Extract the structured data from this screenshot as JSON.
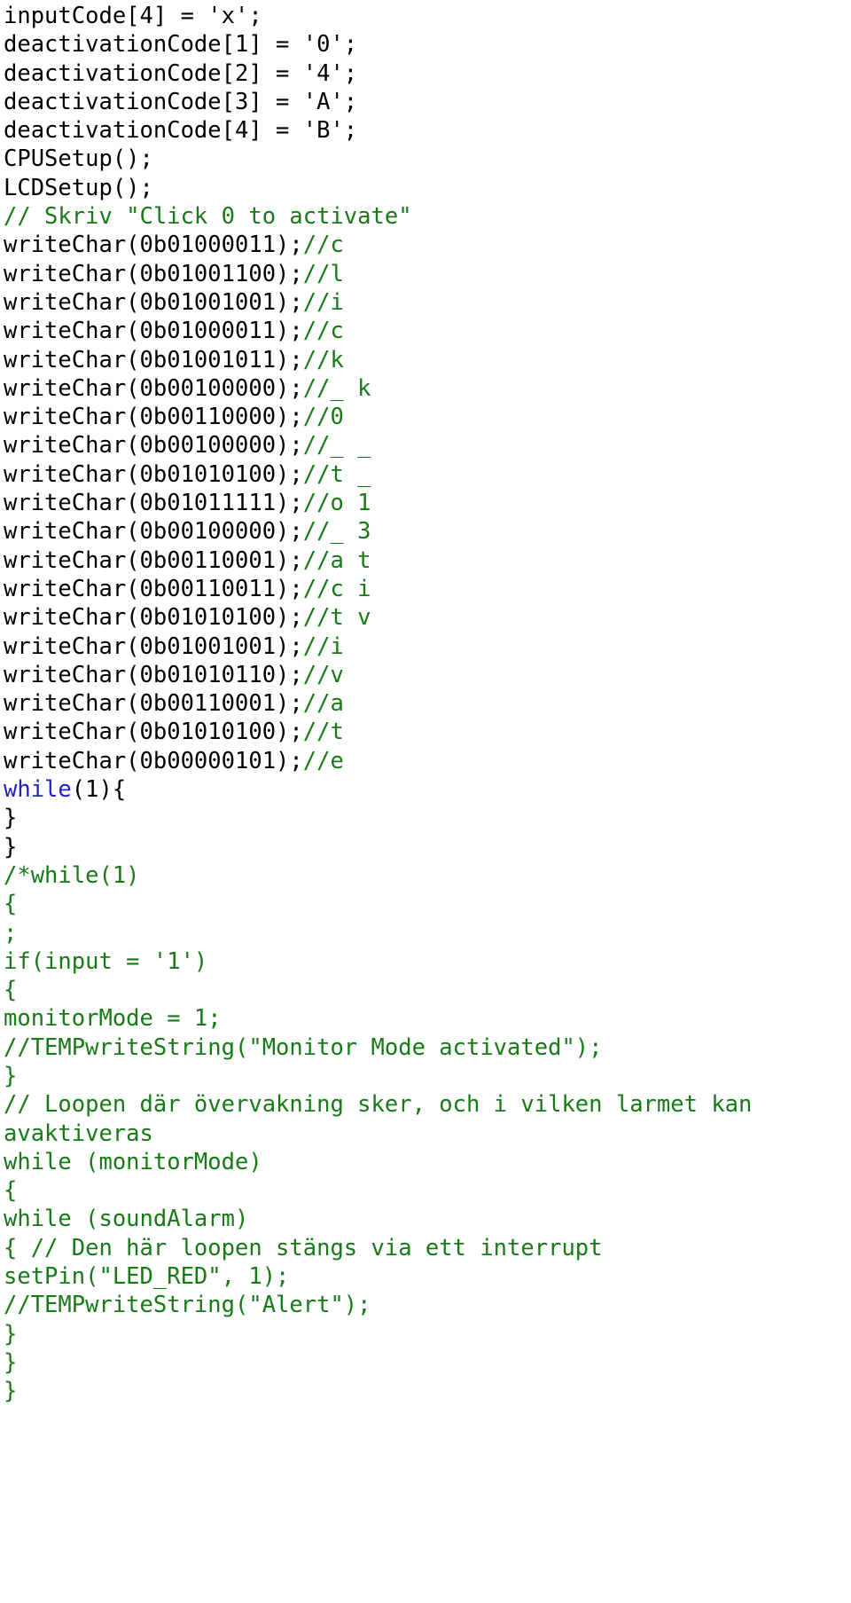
{
  "document": {
    "kind": "source-code-listing",
    "language": "C",
    "colors": {
      "background": "#ffffff",
      "plain": "#000000",
      "comment": "#177a17",
      "keyword": "#2222cc"
    },
    "lines": [
      {
        "id": 1,
        "segments": [
          {
            "style": "plain",
            "text": "inputCode[4] = 'x';"
          }
        ]
      },
      {
        "id": 2,
        "segments": [
          {
            "style": "plain",
            "text": "deactivationCode[1] = '0';"
          }
        ]
      },
      {
        "id": 3,
        "segments": [
          {
            "style": "plain",
            "text": "deactivationCode[2] = '4';"
          }
        ]
      },
      {
        "id": 4,
        "segments": [
          {
            "style": "plain",
            "text": "deactivationCode[3] = 'A';"
          }
        ]
      },
      {
        "id": 5,
        "segments": [
          {
            "style": "plain",
            "text": "deactivationCode[4] = 'B';"
          }
        ]
      },
      {
        "id": 6,
        "segments": [
          {
            "style": "plain",
            "text": "CPUSetup();"
          }
        ]
      },
      {
        "id": 7,
        "segments": [
          {
            "style": "plain",
            "text": "LCDSetup();"
          }
        ]
      },
      {
        "id": 8,
        "segments": [
          {
            "style": "comment",
            "text": "// Skriv \"Click 0 to activate\""
          }
        ]
      },
      {
        "id": 9,
        "segments": [
          {
            "style": "plain",
            "text": "writeChar(0b01000011);"
          },
          {
            "style": "comment",
            "text": "//c"
          }
        ]
      },
      {
        "id": 10,
        "segments": [
          {
            "style": "plain",
            "text": "writeChar(0b01001100);"
          },
          {
            "style": "comment",
            "text": "//l"
          }
        ]
      },
      {
        "id": 11,
        "segments": [
          {
            "style": "plain",
            "text": "writeChar(0b01001001);"
          },
          {
            "style": "comment",
            "text": "//i"
          }
        ]
      },
      {
        "id": 12,
        "segments": [
          {
            "style": "plain",
            "text": "writeChar(0b01000011);"
          },
          {
            "style": "comment",
            "text": "//c"
          }
        ]
      },
      {
        "id": 13,
        "segments": [
          {
            "style": "plain",
            "text": "writeChar(0b01001011);"
          },
          {
            "style": "comment",
            "text": "//k"
          }
        ]
      },
      {
        "id": 14,
        "segments": [
          {
            "style": "plain",
            "text": "writeChar(0b00100000);"
          },
          {
            "style": "comment",
            "text": "//_ k"
          }
        ]
      },
      {
        "id": 15,
        "segments": [
          {
            "style": "plain",
            "text": "writeChar(0b00110000);"
          },
          {
            "style": "comment",
            "text": "//0"
          }
        ]
      },
      {
        "id": 16,
        "segments": [
          {
            "style": "plain",
            "text": "writeChar(0b00100000);"
          },
          {
            "style": "comment",
            "text": "//_ _"
          }
        ]
      },
      {
        "id": 17,
        "segments": [
          {
            "style": "plain",
            "text": "writeChar(0b01010100);"
          },
          {
            "style": "comment",
            "text": "//t _"
          }
        ]
      },
      {
        "id": 18,
        "segments": [
          {
            "style": "plain",
            "text": "writeChar(0b01011111);"
          },
          {
            "style": "comment",
            "text": "//o 1"
          }
        ]
      },
      {
        "id": 19,
        "segments": [
          {
            "style": "plain",
            "text": "writeChar(0b00100000);"
          },
          {
            "style": "comment",
            "text": "//_ 3"
          }
        ]
      },
      {
        "id": 20,
        "segments": [
          {
            "style": "plain",
            "text": "writeChar(0b00110001);"
          },
          {
            "style": "comment",
            "text": "//a t"
          }
        ]
      },
      {
        "id": 21,
        "segments": [
          {
            "style": "plain",
            "text": "writeChar(0b00110011);"
          },
          {
            "style": "comment",
            "text": "//c i"
          }
        ]
      },
      {
        "id": 22,
        "segments": [
          {
            "style": "plain",
            "text": "writeChar(0b01010100);"
          },
          {
            "style": "comment",
            "text": "//t v"
          }
        ]
      },
      {
        "id": 23,
        "segments": [
          {
            "style": "plain",
            "text": "writeChar(0b01001001);"
          },
          {
            "style": "comment",
            "text": "//i"
          }
        ]
      },
      {
        "id": 24,
        "segments": [
          {
            "style": "plain",
            "text": "writeChar(0b01010110);"
          },
          {
            "style": "comment",
            "text": "//v"
          }
        ]
      },
      {
        "id": 25,
        "segments": [
          {
            "style": "plain",
            "text": "writeChar(0b00110001);"
          },
          {
            "style": "comment",
            "text": "//a"
          }
        ]
      },
      {
        "id": 26,
        "segments": [
          {
            "style": "plain",
            "text": "writeChar(0b01010100);"
          },
          {
            "style": "comment",
            "text": "//t"
          }
        ]
      },
      {
        "id": 27,
        "segments": [
          {
            "style": "plain",
            "text": "writeChar(0b00000101);"
          },
          {
            "style": "comment",
            "text": "//e"
          }
        ]
      },
      {
        "id": 28,
        "segments": [
          {
            "style": "keyword",
            "text": "while"
          },
          {
            "style": "plain",
            "text": "(1){"
          }
        ]
      },
      {
        "id": 29,
        "segments": [
          {
            "style": "plain",
            "text": "}"
          }
        ]
      },
      {
        "id": 30,
        "segments": [
          {
            "style": "plain",
            "text": "}"
          }
        ]
      },
      {
        "id": 31,
        "segments": [
          {
            "style": "comment",
            "text": "/*while(1)"
          }
        ]
      },
      {
        "id": 32,
        "segments": [
          {
            "style": "comment",
            "text": "{"
          }
        ]
      },
      {
        "id": 33,
        "segments": [
          {
            "style": "comment",
            "text": ";"
          }
        ]
      },
      {
        "id": 34,
        "segments": [
          {
            "style": "comment",
            "text": "if(input = '1')"
          }
        ]
      },
      {
        "id": 35,
        "segments": [
          {
            "style": "comment",
            "text": "{"
          }
        ]
      },
      {
        "id": 36,
        "segments": [
          {
            "style": "comment",
            "text": "monitorMode = 1;"
          }
        ]
      },
      {
        "id": 37,
        "segments": [
          {
            "style": "comment",
            "text": "//TEMPwriteString(\"Monitor Mode activated\");"
          }
        ]
      },
      {
        "id": 38,
        "segments": [
          {
            "style": "comment",
            "text": "}"
          }
        ]
      },
      {
        "id": 39,
        "segments": [
          {
            "style": "comment",
            "text": "// Loopen där övervakning sker, och i vilken larmet kan avaktiveras"
          }
        ]
      },
      {
        "id": 40,
        "segments": [
          {
            "style": "comment",
            "text": "while (monitorMode)"
          }
        ]
      },
      {
        "id": 41,
        "segments": [
          {
            "style": "comment",
            "text": "{"
          }
        ]
      },
      {
        "id": 42,
        "segments": [
          {
            "style": "comment",
            "text": "while (soundAlarm)"
          }
        ]
      },
      {
        "id": 43,
        "segments": [
          {
            "style": "comment",
            "text": "{ // Den här loopen stängs via ett interrupt"
          }
        ]
      },
      {
        "id": 44,
        "segments": [
          {
            "style": "comment",
            "text": "setPin(\"LED_RED\", 1);"
          }
        ]
      },
      {
        "id": 45,
        "segments": [
          {
            "style": "comment",
            "text": "//TEMPwriteString(\"Alert\");"
          }
        ]
      },
      {
        "id": 46,
        "segments": [
          {
            "style": "comment",
            "text": "}"
          }
        ]
      },
      {
        "id": 47,
        "segments": [
          {
            "style": "comment",
            "text": "}"
          }
        ]
      },
      {
        "id": 48,
        "segments": [
          {
            "style": "comment",
            "text": "}"
          }
        ]
      }
    ]
  }
}
